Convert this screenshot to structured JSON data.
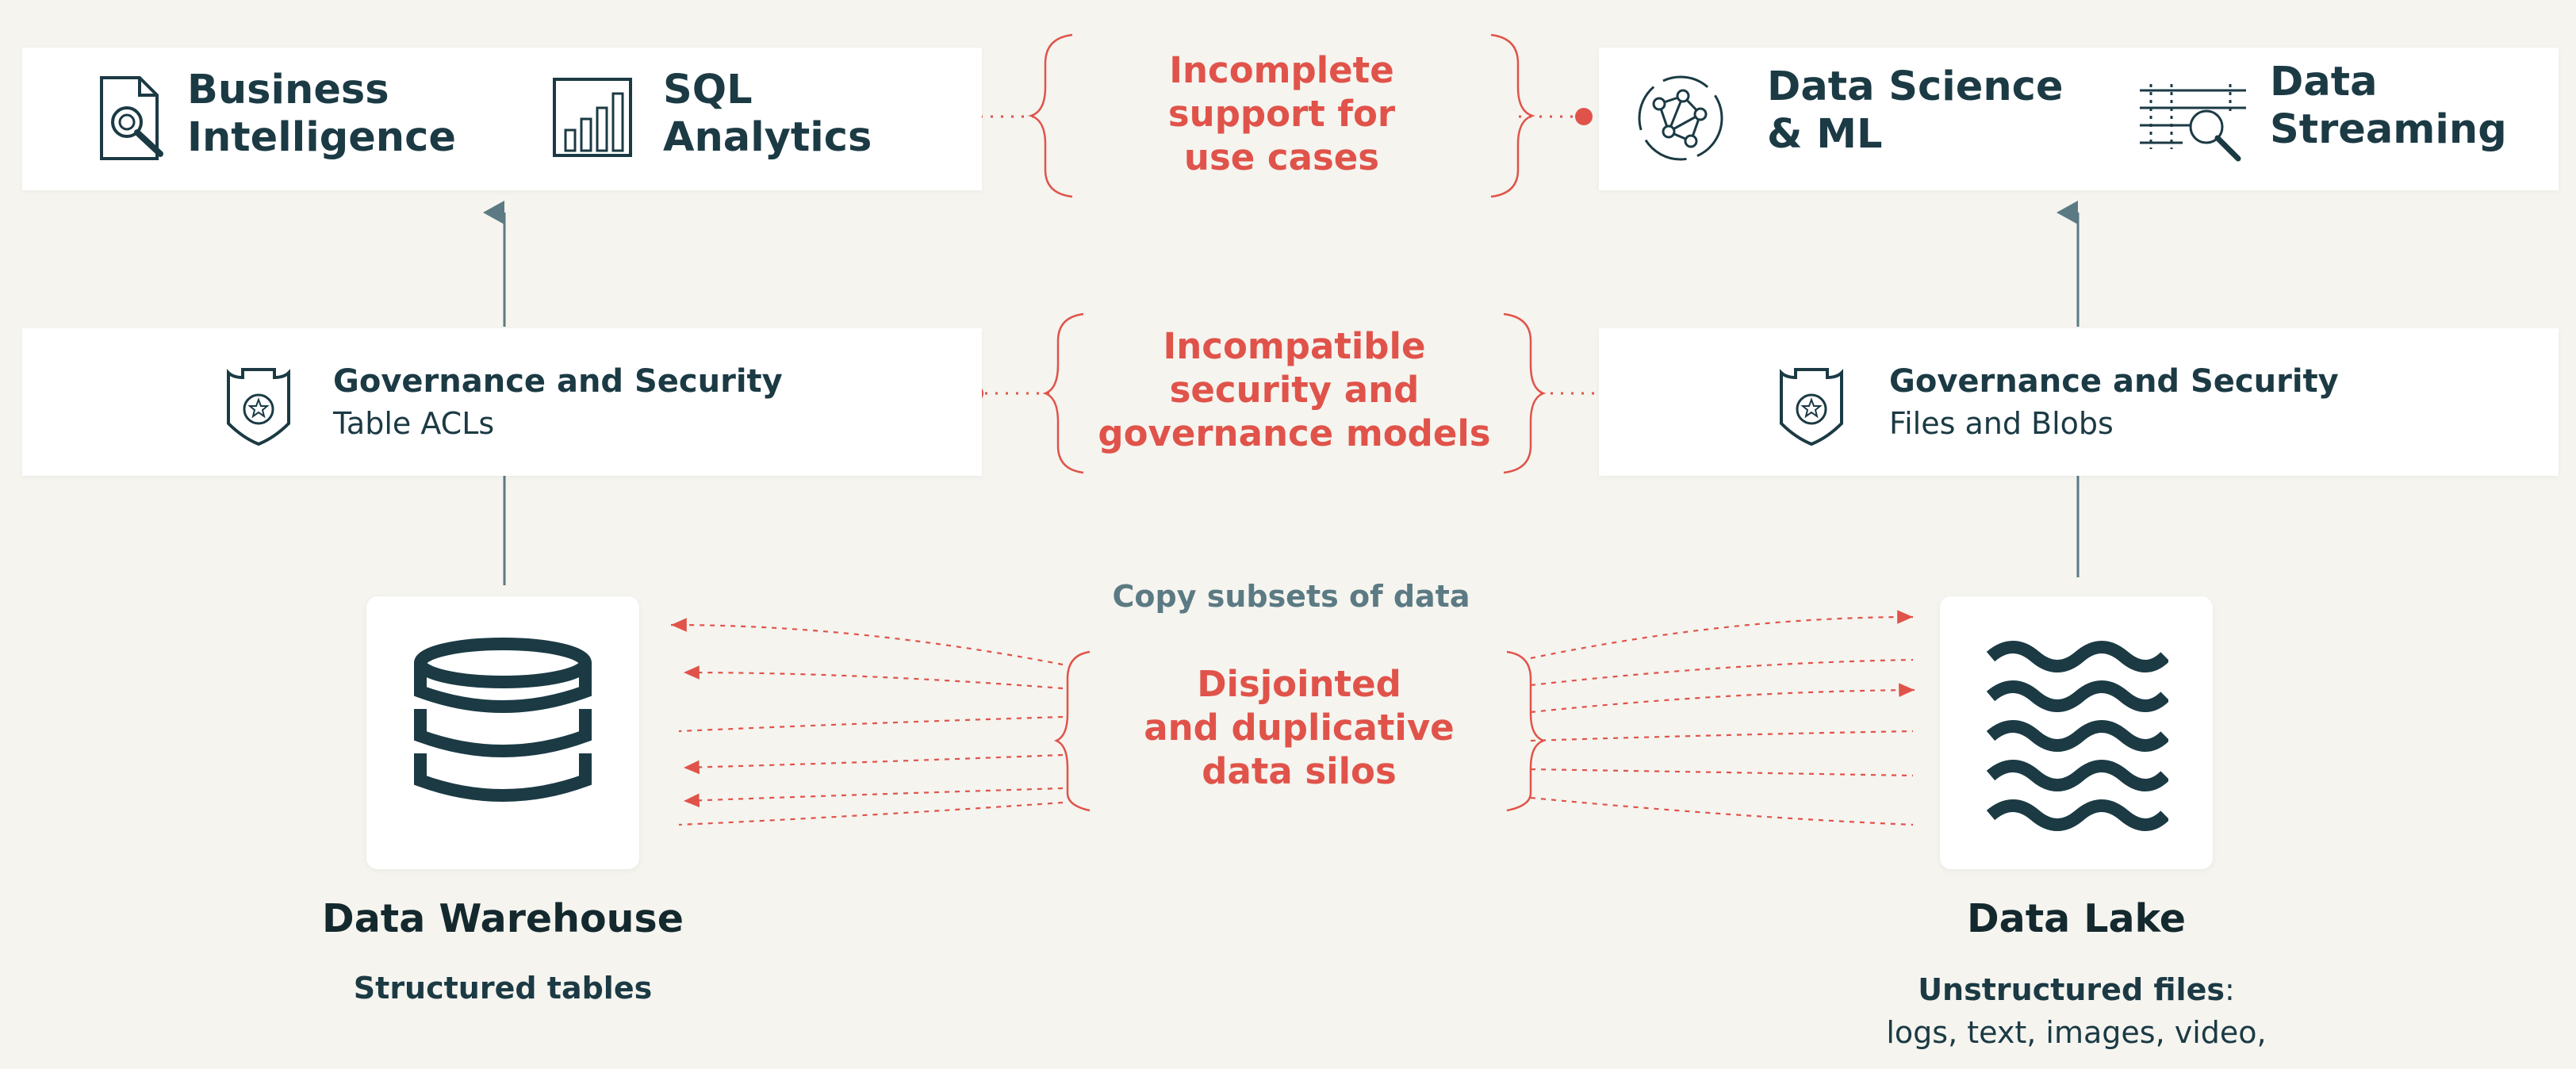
{
  "top_left": {
    "bi_line1": "Business",
    "bi_line2": "Intelligence",
    "sql_line1": "SQL",
    "sql_line2": "Analytics",
    "icons": [
      "document-search-icon",
      "bar-chart-icon"
    ]
  },
  "top_right": {
    "ds_line1": "Data Science",
    "ds_line2": "& ML",
    "stream_line1": "Data",
    "stream_line2": "Streaming",
    "icons": [
      "network-graph-icon",
      "data-streaming-icon"
    ]
  },
  "governance_left": {
    "title": "Governance and Security",
    "subtitle": "Table ACLs",
    "icon": "shield-badge-icon"
  },
  "governance_right": {
    "title": "Governance and Security",
    "subtitle": "Files and Blobs",
    "icon": "shield-badge-icon"
  },
  "callouts": {
    "use_cases": [
      "Incomplete",
      "support for",
      "use cases"
    ],
    "security": [
      "Incompatible",
      "security and",
      "governance models"
    ],
    "silos": [
      "Disjointed",
      "and duplicative",
      "data silos"
    ]
  },
  "copy_label": "Copy subsets of data",
  "warehouse": {
    "title": "Data Warehouse",
    "subtitle": "Structured tables",
    "icon": "database-icon"
  },
  "lake": {
    "title": "Data Lake",
    "subtitle_bold": "Unstructured files",
    "subtitle_colon": ":",
    "subtitle_line2": "logs, text, images, video,",
    "icon": "waves-icon"
  },
  "colors": {
    "background": "#f5f4ef",
    "dark_teal": "#1b3a44",
    "accent_red": "#e0534a",
    "muted_teal": "#5b7a83"
  }
}
